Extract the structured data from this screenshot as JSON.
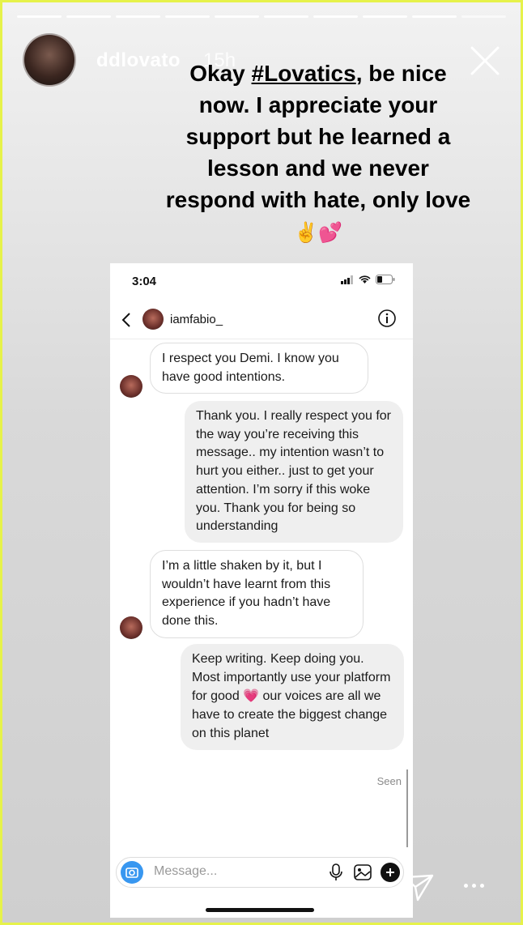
{
  "story": {
    "username": "ddlovato",
    "time_ago": "15h",
    "segments": 10,
    "caption": {
      "line1_pre": "Okay ",
      "hashtag": "#Lovatics",
      "line1_post": ", be nice now. I appreciate your support but he learned a lesson and we never respond with hate, only love",
      "emojis": "✌️💕"
    }
  },
  "screenshot": {
    "status_time": "3:04",
    "chat_peer": "iamfabio_",
    "messages": [
      {
        "from": "peer",
        "text": "I respect you Demi. I know you have good intentions."
      },
      {
        "from": "me",
        "text": "Thank you. I really respect you for the way you’re receiving this message.. my intention wasn’t to hurt you either.. just to get your attention. I’m sorry if this woke you. Thank you for being so understanding"
      },
      {
        "from": "peer",
        "text": "I’m a little shaken by it, but I wouldn’t have learnt from this experience if you hadn’t have done this."
      },
      {
        "from": "me",
        "text_pre": "Keep writing. Keep doing you. Most importantly use your platform for good ",
        "emoji": "💗",
        "text_post": " our voices are all we have to create the biggest change on this planet"
      }
    ],
    "seen_label": "Seen",
    "composer_placeholder": "Message..."
  },
  "colors": {
    "frame_border": "#e6f24a",
    "camera_button": "#3897f0",
    "outgoing_bubble": "#efefef"
  }
}
